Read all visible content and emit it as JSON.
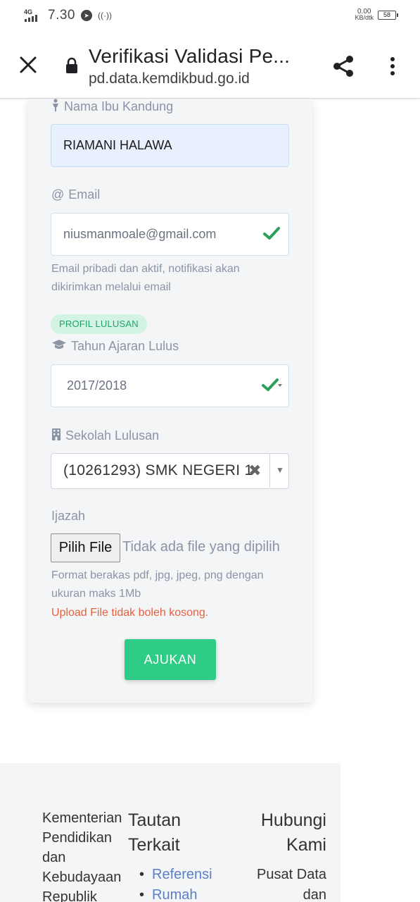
{
  "status_bar": {
    "network": "4G",
    "time": "7.30",
    "speed_value": "0.00",
    "speed_unit": "KB/dtk",
    "battery": "58"
  },
  "browser": {
    "title": "Verifikasi Validasi Pe...",
    "url": "pd.data.kemdikbud.go.id"
  },
  "form": {
    "mother_label": "Nama Ibu Kandung",
    "mother_value": "RIAMANI HALAWA",
    "email_label": "Email",
    "email_value": "niusmanmoale@gmail.com",
    "email_help": "Email pribadi dan aktif, notifikasi akan dikirimkan melalui email",
    "section_badge": "PROFIL LULUSAN",
    "year_label": "Tahun Ajaran Lulus",
    "year_value": "2017/2018",
    "school_label": "Sekolah Lulusan",
    "school_value": "(10261293) SMK NEGERI 1",
    "ijazah_label": "Ijazah",
    "file_button": "Pilih File",
    "file_status": "Tidak ada file yang dipilih",
    "file_help": "Format berakas pdf, jpg, jpeg, png dengan ukuran maks 1Mb",
    "file_error": "Upload File tidak boleh kosong.",
    "submit_label": "AJUKAN"
  },
  "footer": {
    "org_lines": [
      "Kementerian",
      "Pendidikan",
      "dan",
      "Kebudayaan",
      "Republik"
    ],
    "links_title_1": "Tautan",
    "links_title_2": "Terkait",
    "links": [
      "Referensi",
      "Rumah"
    ],
    "contact_title_1": "Hubungi",
    "contact_title_2": "Kami",
    "contact_lines": [
      "Pusat Data",
      "dan"
    ]
  },
  "colors": {
    "accent_green": "#2ecc87",
    "check_green": "#2e9e5b",
    "error_red": "#e5613f",
    "link_blue": "#5b7fc5",
    "muted_label": "#8a94a6"
  }
}
